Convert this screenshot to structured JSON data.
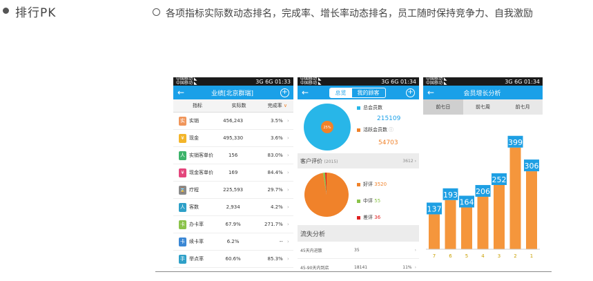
{
  "header": {
    "title": "排行PK",
    "description": "各项指标实际数动态排名，完成率、增长率动态排名，员工随时保持竞争力、自我激励"
  },
  "status": {
    "left_top": "中国移动 ◣",
    "left_bottom": "中国移动 ◣",
    "phone1_time": "01:33",
    "phone2_time": "01:34",
    "phone3_time": "01:34",
    "signal": "3G 6G"
  },
  "phone1": {
    "title": "业绩[北京群瑞]",
    "columns": [
      "指标",
      "实际数",
      "完成率"
    ],
    "rows": [
      {
        "name": "实销",
        "value": "456,243",
        "rate": "3.5%",
        "color": "#f0955a",
        "icon": "实"
      },
      {
        "name": "现金",
        "value": "495,330",
        "rate": "3.6%",
        "color": "#f3b52a",
        "icon": "¥"
      },
      {
        "name": "实销客单价",
        "value": "156",
        "rate": "83.0%",
        "color": "#3cb36a",
        "icon": "人"
      },
      {
        "name": "现金客单价",
        "value": "169",
        "rate": "84.4%",
        "color": "#e4467c",
        "icon": "¥"
      },
      {
        "name": "疗程",
        "value": "225,593",
        "rate": "29.7%",
        "color": "#8a8a8a",
        "icon": "⌛"
      },
      {
        "name": "客数",
        "value": "2,934",
        "rate": "4.2%",
        "color": "#2ea0c8",
        "icon": "人"
      },
      {
        "name": "办卡率",
        "value": "67.9%",
        "rate": "271.7%",
        "color": "#8bc34a",
        "icon": "卡"
      },
      {
        "name": "续卡率",
        "value": "6.2%",
        "rate": "--",
        "color": "#3a87d4",
        "icon": "卡"
      },
      {
        "name": "举点率",
        "value": "60.6%",
        "rate": "85.3%",
        "color": "#2ea0c8",
        "icon": "手"
      }
    ]
  },
  "phone2": {
    "tab_active": "总览",
    "tab_other": "我的顾客",
    "member": {
      "total_label": "总会员数",
      "total_value": "215109",
      "active_label": "活跃会员数",
      "active_value": "54703",
      "pie_label": "25%",
      "active_share": 25
    },
    "review": {
      "title": "客户评价",
      "count": "(2015)",
      "total": "3612",
      "good_label": "好评",
      "good_value": "3520",
      "mid_label": "中评",
      "mid_value": "55",
      "bad_label": "差评",
      "bad_value": "36"
    },
    "loss": {
      "title": "流失分析",
      "rows": [
        {
          "label": "45天内进散",
          "value": "35",
          "pct": ""
        },
        {
          "label": "45-90天内到店",
          "value": "18141",
          "pct": "11%"
        }
      ]
    },
    "colors": {
      "member": "#28b6e8",
      "active": "#f0822a",
      "good": "#f0822a",
      "mid": "#8bc34a",
      "bad": "#e02020"
    }
  },
  "phone3": {
    "title": "会员增长分析",
    "tabs": [
      "前七日",
      "前七周",
      "前七月"
    ],
    "active_tab": 0,
    "chart_data": {
      "type": "bar",
      "categories": [
        "7",
        "6",
        "5",
        "4",
        "3",
        "2",
        "1"
      ],
      "values": [
        137,
        193,
        164,
        206,
        252,
        399,
        306
      ],
      "ylim": [
        0,
        420
      ],
      "bar_color": "#f5963c",
      "label_color": "#1e9fe3",
      "grid": false
    }
  }
}
